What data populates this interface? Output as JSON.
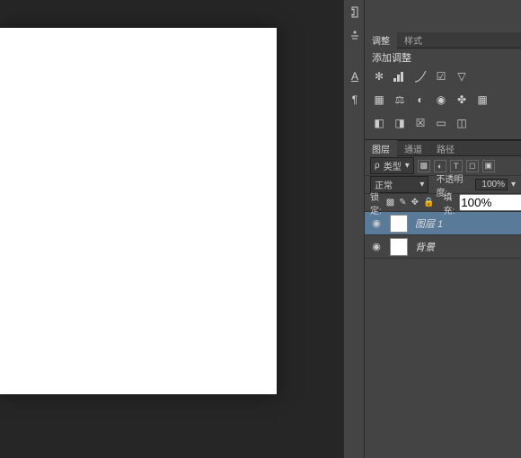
{
  "tabs_top": {
    "adjust": "调整",
    "styles": "样式"
  },
  "section_title": "添加调整",
  "tabs_layers": {
    "layers": "图层",
    "channels": "通道",
    "paths": "路径"
  },
  "filter": {
    "label": "类型"
  },
  "blend": {
    "mode": "正常",
    "opacity_label": "不透明度:",
    "opacity_val": "100%"
  },
  "lock": {
    "label": "锁定:",
    "fill_label": "填充:",
    "fill_val": "100%"
  },
  "layers": [
    {
      "name": "图层 1"
    },
    {
      "name": "背景"
    }
  ],
  "toolstrip_labels": {
    "char": "A",
    "para": "¶"
  }
}
